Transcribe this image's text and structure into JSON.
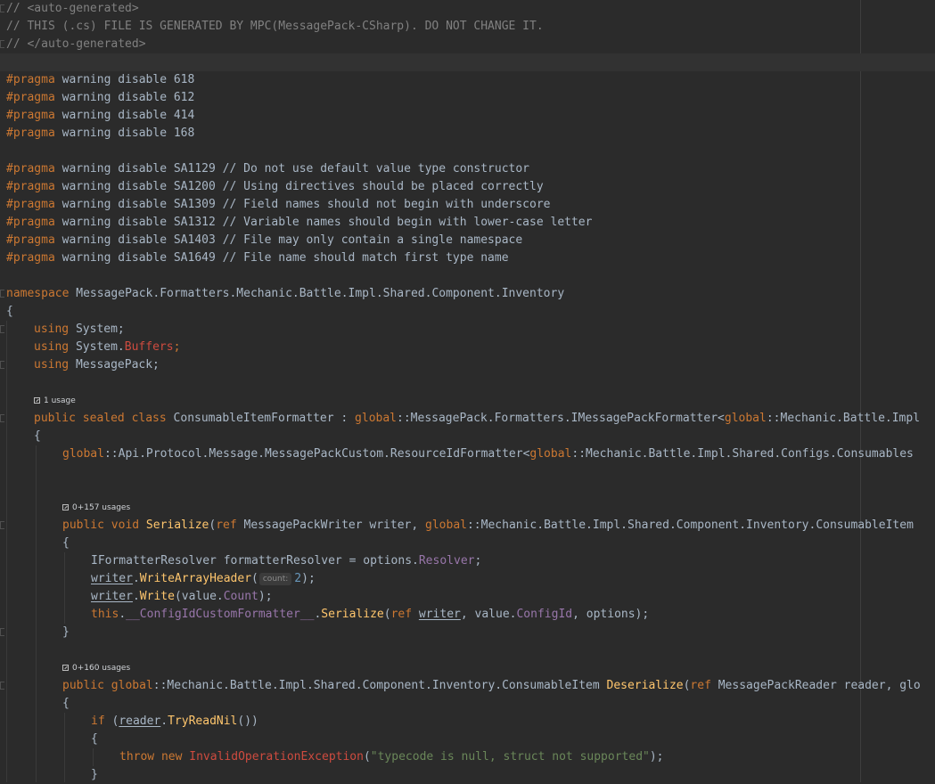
{
  "header_comment": [
    "// <auto-generated>",
    "// THIS (.cs) FILE IS GENERATED BY MPC(MessagePack-CSharp). DO NOT CHANGE IT.",
    "// </auto-generated>"
  ],
  "pragmas_numeric": [
    {
      "directive": "#pragma",
      "rest": " warning disable 618"
    },
    {
      "directive": "#pragma",
      "rest": " warning disable 612"
    },
    {
      "directive": "#pragma",
      "rest": " warning disable 414"
    },
    {
      "directive": "#pragma",
      "rest": " warning disable 168"
    }
  ],
  "pragmas_sa": [
    {
      "directive": "#pragma",
      "rest": " warning disable SA1129 // Do not use default value type constructor"
    },
    {
      "directive": "#pragma",
      "rest": " warning disable SA1200 // Using directives should be placed correctly"
    },
    {
      "directive": "#pragma",
      "rest": " warning disable SA1309 // Field names should not begin with underscore"
    },
    {
      "directive": "#pragma",
      "rest": " warning disable SA1312 // Variable names should begin with lower-case letter"
    },
    {
      "directive": "#pragma",
      "rest": " warning disable SA1403 // File may only contain a single namespace"
    },
    {
      "directive": "#pragma",
      "rest": " warning disable SA1649 // File name should match first type name"
    }
  ],
  "namespace": {
    "keyword": "namespace",
    "name": " MessagePack.Formatters.Mechanic.Battle.Impl.Shared.Component.Inventory"
  },
  "usings": [
    {
      "keyword": "using",
      "name": " System;"
    },
    {
      "keyword": "using",
      "name": " System.",
      "extra": "Buffers",
      "end": ";"
    },
    {
      "keyword": "using",
      "name": " MessagePack;"
    }
  ],
  "usage_hints": {
    "class": "1 usage",
    "serialize": "0+157 usages",
    "deserialize": "0+160 usages"
  },
  "class_decl": {
    "modifiers": "public sealed class",
    "name": " ConsumableItemFormatter : ",
    "global": "global",
    "base": "::MessagePack.Formatters.IMessagePackFormatter<",
    "global2": "global",
    "tail": "::Mechanic.Battle.Impl"
  },
  "field_decl": {
    "global": "global",
    "type": "::Api.Protocol.Message.MessagePackCustom.ResourceIdFormatter<",
    "global2": "global",
    "tail": "::Mechanic.Battle.Impl.Shared.Configs.Consumables"
  },
  "serialize": {
    "modifiers": "public void",
    "name": "Serialize",
    "ref": "ref",
    "params": " MessagePackWriter writer, ",
    "global": "global",
    "ptype": "::Mechanic.Battle.Impl.Shared.Component.Inventory.ConsumableItem",
    "body": {
      "resolver_decl": "IFormatterResolver formatterResolver = options.",
      "resolver_prop": "Resolver",
      "writer": "writer",
      "write_array_header": "WriteArrayHeader",
      "count_hint": "count:",
      "count_value": "2",
      "write": "Write",
      "value_count_pre": "(value.",
      "value_count": "Count",
      "this": "this",
      "field": "__ConfigIdCustomFormatter__",
      "serialize_call": "Serialize",
      "config_pre": ", value.",
      "config_id": "ConfigId",
      "options_end": ", options);"
    }
  },
  "deserialize": {
    "modifiers": "public",
    "global": "global",
    "rtype": "::Mechanic.Battle.Impl.Shared.Component.Inventory.ConsumableItem ",
    "name": "Deserialize",
    "ref": "ref",
    "params": " MessagePackReader reader, ",
    "tail": "glo",
    "body": {
      "if": "if",
      "reader": "reader",
      "try_read_nil": "TryReadNil",
      "throw": "throw",
      "new": "new",
      "exception": "InvalidOperationException",
      "message": "\"typecode is null, struct not supported\""
    }
  },
  "colors": {
    "background": "#2b2b2b",
    "keyword": "#cc7832",
    "comment": "#808080",
    "function": "#ffc66d",
    "property": "#9876aa",
    "string": "#6a8759",
    "number": "#6897bb",
    "text": "#a9b7c6"
  }
}
